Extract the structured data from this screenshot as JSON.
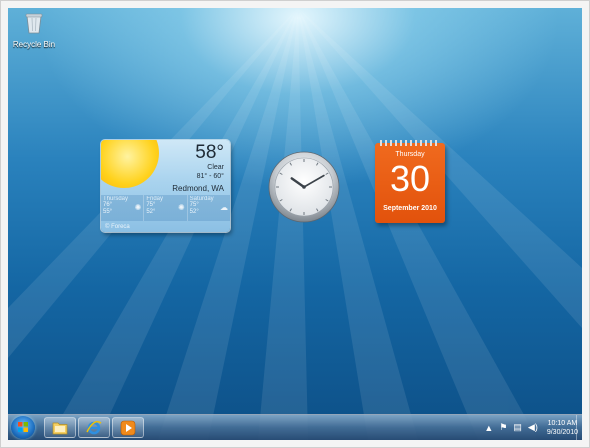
{
  "desktop": {
    "icons": [
      {
        "label": "Recycle Bin",
        "icon": "recycle-bin-icon"
      }
    ]
  },
  "weather": {
    "temperature": "58°",
    "condition": "Clear",
    "range": "81° - 60°",
    "location": "Redmond, WA",
    "forecast": [
      {
        "day": "Thursday",
        "high": "76°",
        "low": "55°",
        "icon": "sun-icon"
      },
      {
        "day": "Friday",
        "high": "75°",
        "low": "52°",
        "icon": "sun-icon"
      },
      {
        "day": "Saturday",
        "high": "75°",
        "low": "52°",
        "icon": "partly-cloudy-icon"
      }
    ],
    "credit": "© Foreca"
  },
  "clock": {
    "hour": 10,
    "minute": 10
  },
  "calendar": {
    "weekday": "Thursday",
    "day": "30",
    "month_year": "September 2010"
  },
  "taskbar": {
    "pinned": [
      {
        "name": "explorer",
        "icon": "folder-icon"
      },
      {
        "name": "internet-explorer",
        "icon": "ie-icon"
      },
      {
        "name": "media-player",
        "icon": "play-icon"
      }
    ],
    "tray": {
      "time": "10:10 AM",
      "date": "9/30/2010"
    }
  },
  "colors": {
    "calendar_accent": "#e2520c",
    "desktop_blue": "#1466a3"
  }
}
